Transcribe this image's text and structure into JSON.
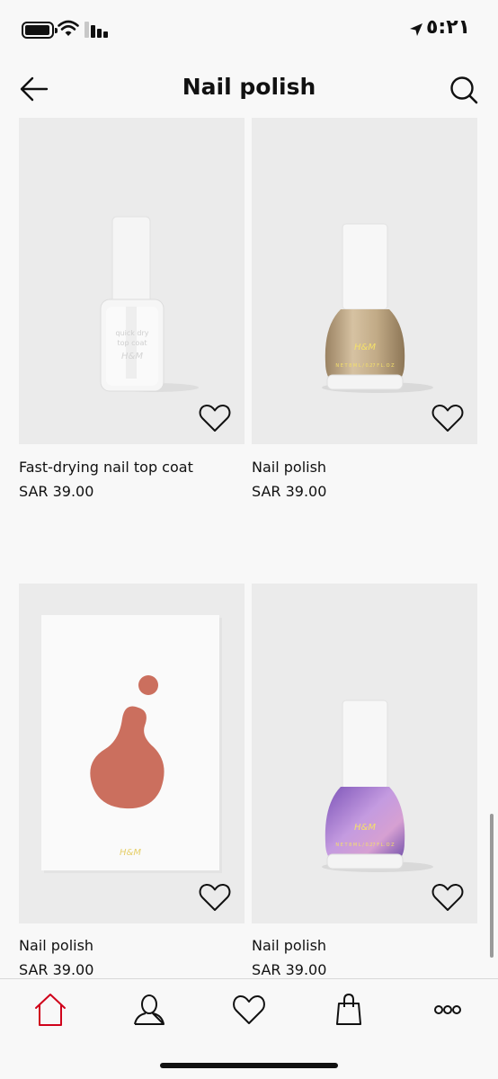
{
  "status_bar": {
    "time": "٥:٢١",
    "icons": [
      "battery-icon",
      "wifi-icon",
      "signal-icon",
      "location-arrow-icon"
    ]
  },
  "header": {
    "title": "Nail polish",
    "back_icon": "arrow-left-icon",
    "search_icon": "search-icon"
  },
  "products": [
    {
      "name": "Fast-drying nail top coat",
      "price": "SAR 39.00",
      "image": "clear-top-coat-bottle",
      "wishlist_icon": "heart-icon"
    },
    {
      "name": "Nail polish",
      "price": "SAR 39.00",
      "image": "gold-polish-bottle",
      "wishlist_icon": "heart-icon"
    },
    {
      "name": "Nail polish",
      "price": "SAR 39.00",
      "image": "coral-swatch-card",
      "wishlist_icon": "heart-icon"
    },
    {
      "name": "Nail polish",
      "price": "SAR 39.00",
      "image": "violet-shimmer-polish-bottle",
      "wishlist_icon": "heart-icon"
    }
  ],
  "tab_bar": {
    "active_tab": "home",
    "active_color": "#d0021b",
    "tabs": [
      "home-icon",
      "profile-icon",
      "favorites-icon",
      "bag-icon",
      "more-icon"
    ]
  }
}
